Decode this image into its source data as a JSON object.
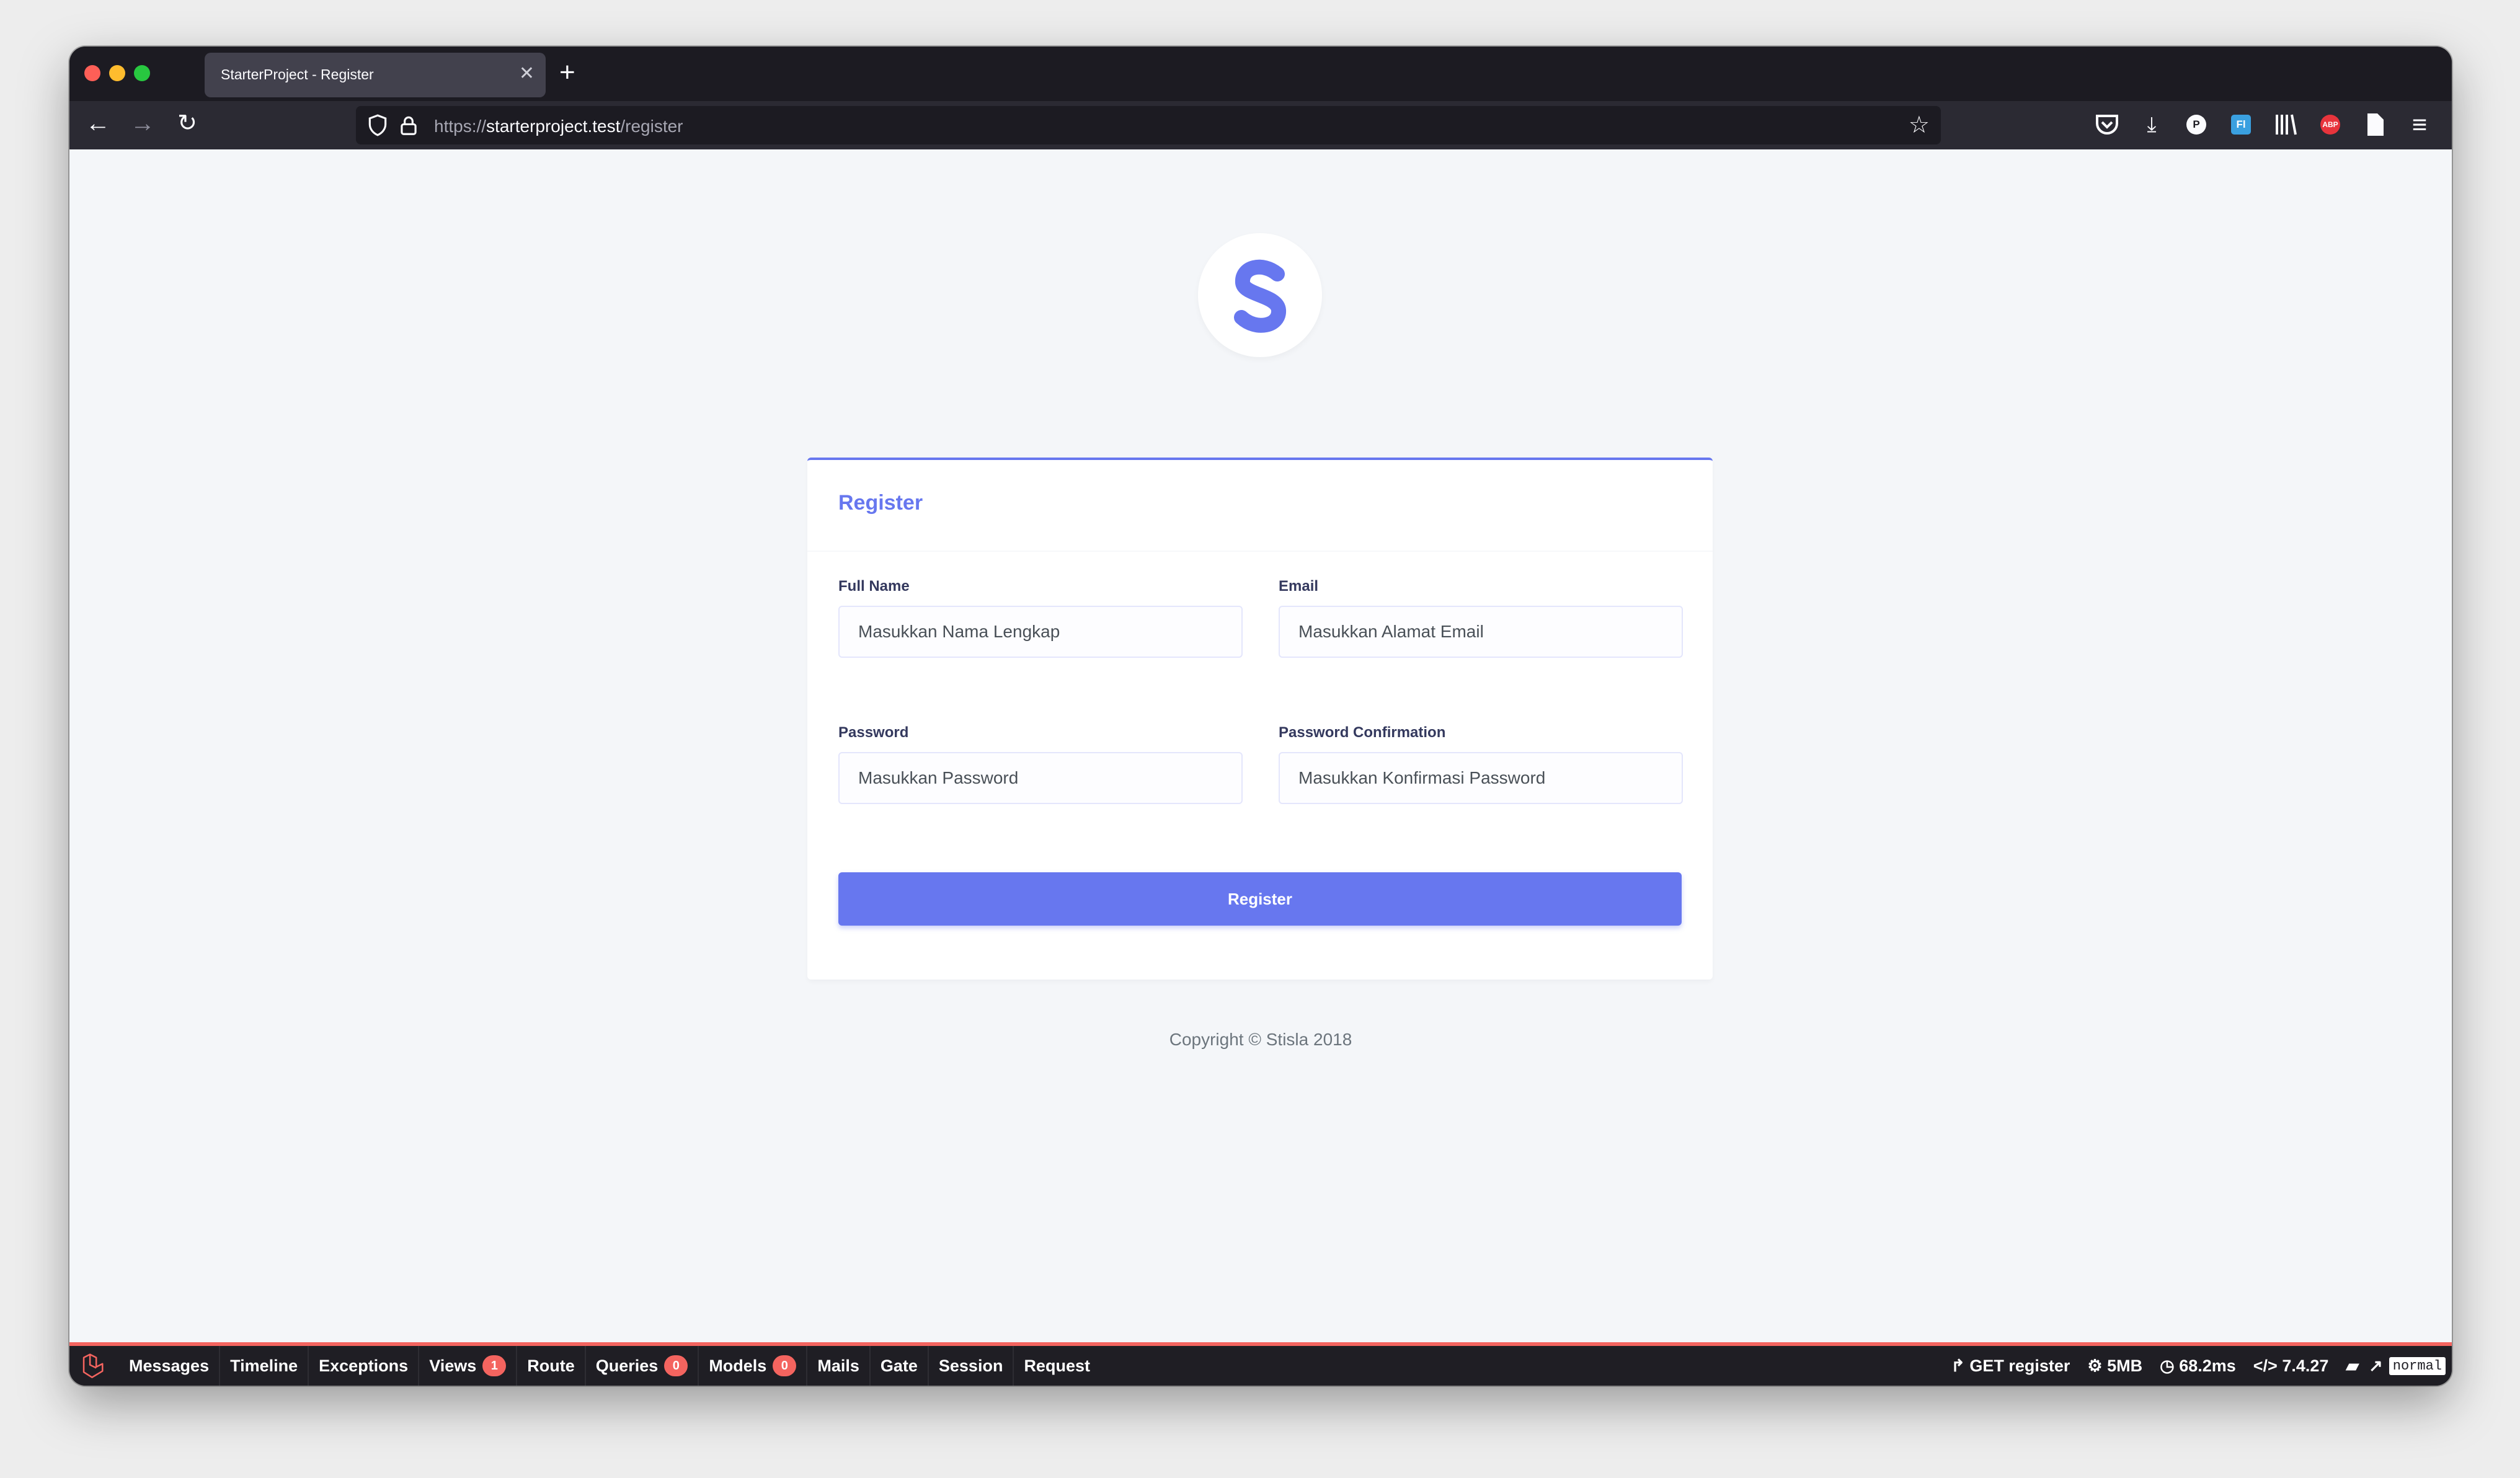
{
  "browser": {
    "tab_title": "StarterProject - Register",
    "tab_close_glyph": "✕",
    "new_tab_glyph": "+",
    "url_scheme": "https://",
    "url_host": "starterproject.test",
    "url_path": "/register",
    "nav_back_glyph": "←",
    "nav_forward_glyph": "→",
    "nav_reload_glyph": "↻",
    "bookmark_glyph": "☆",
    "menu_glyph": "≡",
    "download_glyph": "⤓",
    "extension_p_label": "P",
    "extension_fl_label": "Fl",
    "extension_abp_label": "ABP"
  },
  "page": {
    "logo_letter": "S",
    "card_title": "Register",
    "fields": {
      "full_name": {
        "label": "Full Name",
        "placeholder": "Masukkan Nama Lengkap"
      },
      "email": {
        "label": "Email",
        "placeholder": "Masukkan Alamat Email"
      },
      "password": {
        "label": "Password",
        "placeholder": "Masukkan Password"
      },
      "password_confirmation": {
        "label": "Password Confirmation",
        "placeholder": "Masukkan Konfirmasi Password"
      }
    },
    "submit_label": "Register",
    "copyright": "Copyright © Stisla 2018",
    "accent_color": "#6777ef"
  },
  "debugbar": {
    "tabs": [
      {
        "label": "Messages"
      },
      {
        "label": "Timeline"
      },
      {
        "label": "Exceptions"
      },
      {
        "label": "Views",
        "badge": "1"
      },
      {
        "label": "Route"
      },
      {
        "label": "Queries",
        "badge": "0"
      },
      {
        "label": "Models",
        "badge": "0"
      },
      {
        "label": "Mails"
      },
      {
        "label": "Gate"
      },
      {
        "label": "Session"
      },
      {
        "label": "Request"
      }
    ],
    "route": "GET register",
    "memory": "5MB",
    "duration": "68.2ms",
    "php_version": "7.4.27",
    "mode": "normal",
    "accent_color": "#f4645f"
  }
}
